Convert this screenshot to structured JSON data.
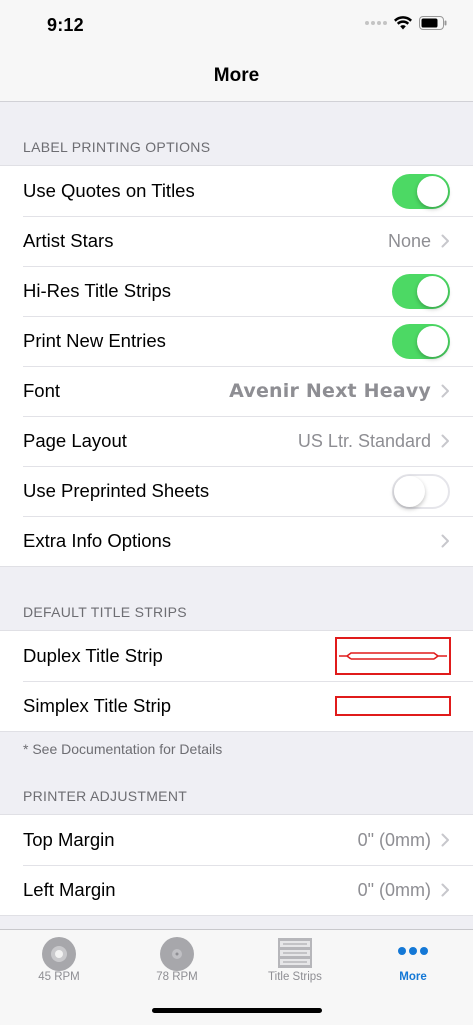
{
  "status_bar": {
    "time": "9:12"
  },
  "navbar": {
    "title": "More"
  },
  "sections": {
    "label_printing": {
      "header": "LABEL PRINTING OPTIONS",
      "use_quotes": {
        "label": "Use Quotes on Titles",
        "on": true
      },
      "artist_stars": {
        "label": "Artist Stars",
        "value": "None"
      },
      "hires_strips": {
        "label": "Hi-Res Title Strips",
        "on": true
      },
      "print_new": {
        "label": "Print New Entries",
        "on": true
      },
      "font": {
        "label": "Font",
        "value": "Avenir Next Heavy"
      },
      "page_layout": {
        "label": "Page Layout",
        "value": "US Ltr. Standard"
      },
      "preprinted": {
        "label": "Use Preprinted Sheets",
        "on": false
      },
      "extra_info": {
        "label": "Extra Info Options"
      }
    },
    "default_strips": {
      "header": "DEFAULT TITLE STRIPS",
      "duplex": {
        "label": "Duplex Title Strip"
      },
      "simplex": {
        "label": "Simplex Title Strip"
      },
      "footer": "* See Documentation for Details"
    },
    "printer_adjustment": {
      "header": "PRINTER ADJUSTMENT",
      "top_margin": {
        "label": "Top Margin",
        "value": "0\" (0mm)"
      },
      "left_margin": {
        "label": "Left Margin",
        "value": "0\" (0mm)"
      }
    }
  },
  "tabbar": {
    "tabs": [
      {
        "label": "45 RPM",
        "icon": "record-45-icon",
        "active": false
      },
      {
        "label": "78 RPM",
        "icon": "record-78-icon",
        "active": false
      },
      {
        "label": "Title Strips",
        "icon": "title-strips-icon",
        "active": false
      },
      {
        "label": "More",
        "icon": "more-icon",
        "active": true
      }
    ],
    "active_color": "#1478d6"
  },
  "colors": {
    "switch_on": "#4cd964",
    "strip_outline": "#e01b1b"
  }
}
